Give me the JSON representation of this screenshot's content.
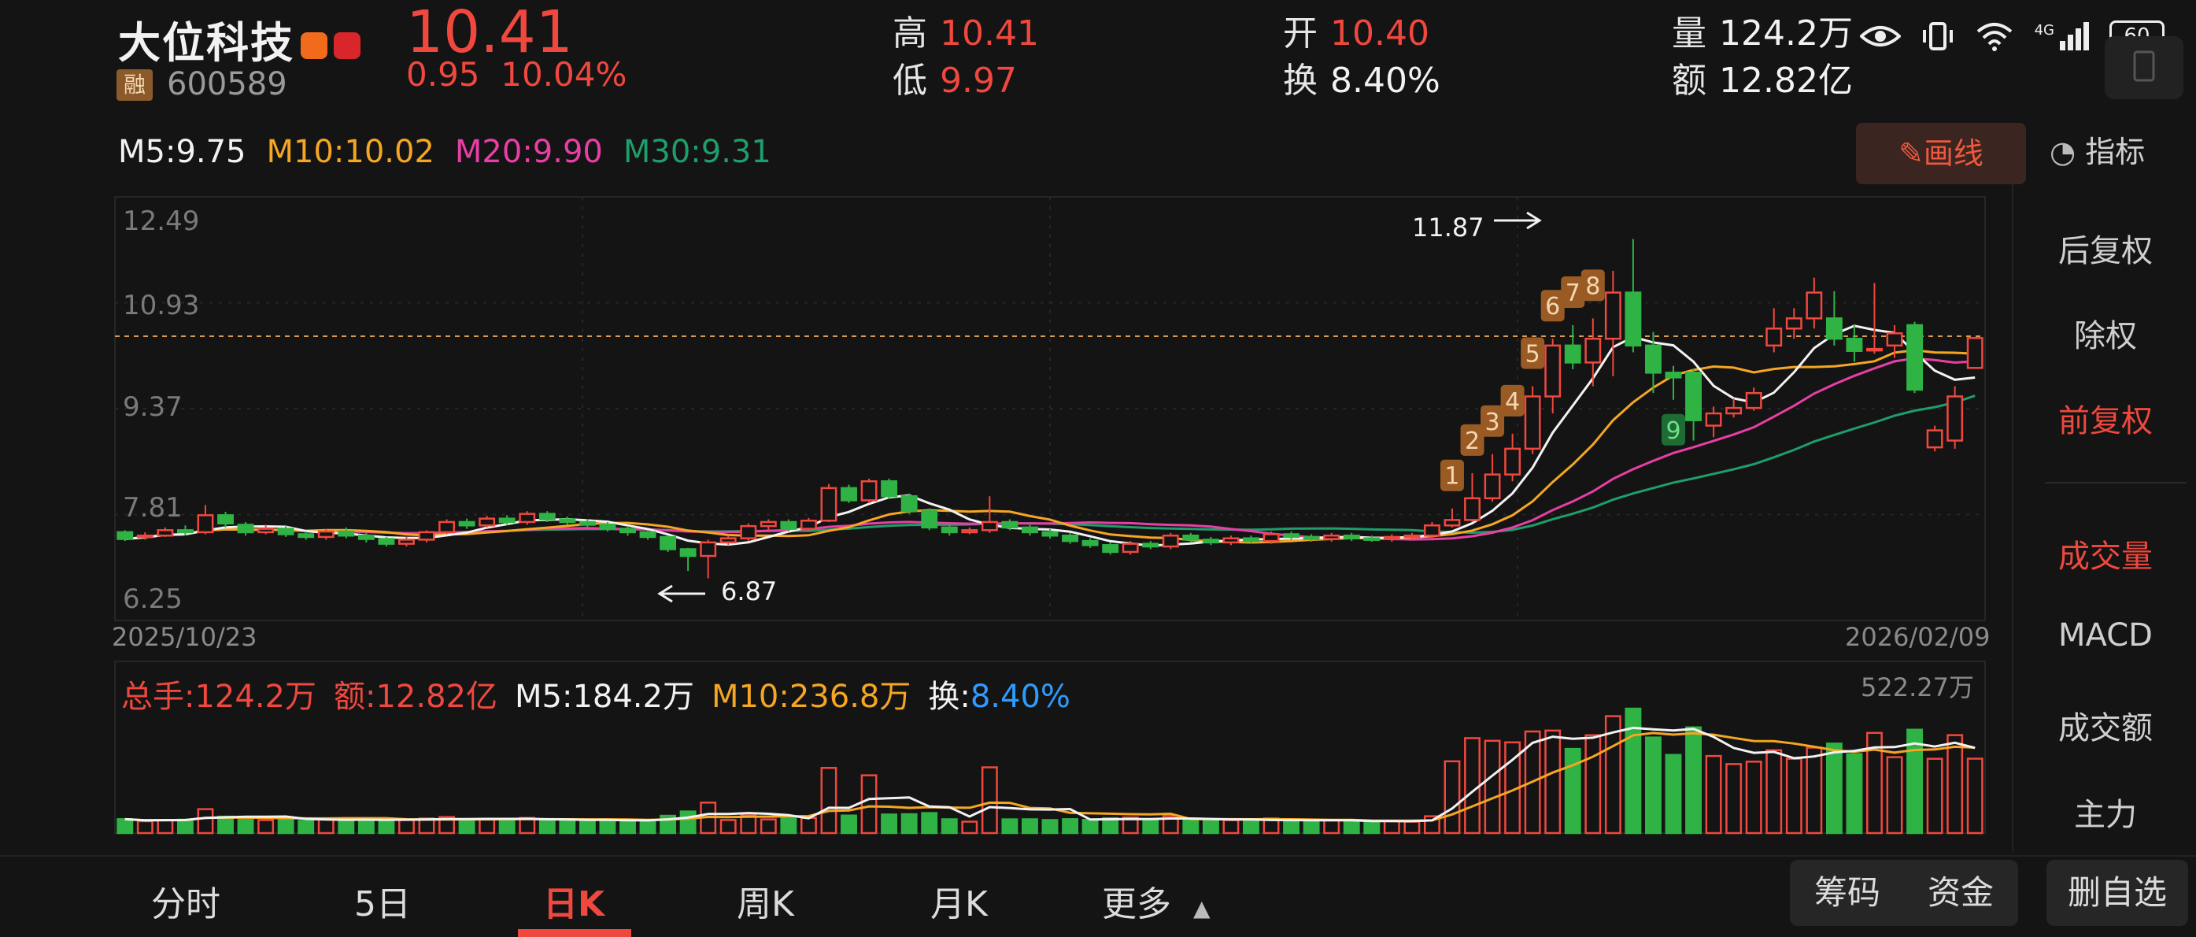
{
  "header": {
    "stock_name": "大位科技",
    "rong_badge": "融",
    "code": "600589",
    "price": "10.41",
    "change": "0.95",
    "change_pct": "10.04%",
    "high_label": "高",
    "high": "10.41",
    "low_label": "低",
    "low": "9.97",
    "open_label": "开",
    "open": "10.40",
    "turnover_label": "换",
    "turnover": "8.40%",
    "volume_label": "量",
    "volume": "124.2万",
    "amount_label": "额",
    "amount": "12.82亿"
  },
  "status_bar": {
    "network": "4G",
    "battery": "60"
  },
  "ma_row": {
    "ma5": "M5:9.75",
    "ma10": "M10:10.02",
    "ma20": "M20:9.90",
    "ma30": "M30:9.31"
  },
  "draw_button": "画线",
  "indicator_button": "指标",
  "side_panel": {
    "items": [
      "后复权",
      "除权",
      "前复权",
      "成交量",
      "MACD",
      "成交额",
      "主力"
    ],
    "active": [
      "前复权",
      "成交量"
    ]
  },
  "chart": {
    "y_ticks": [
      "12.49",
      "10.93",
      "9.37",
      "7.81",
      "6.25"
    ],
    "start_date": "2025/10/23",
    "end_date": "2026/02/09",
    "high_marker": "11.87",
    "low_marker": "6.87",
    "seq_labels": [
      "1",
      "2",
      "3",
      "4",
      "5",
      "6",
      "7",
      "8"
    ],
    "seq_nine": "9",
    "colors": {
      "up": "#f0483e",
      "down": "#2fb344",
      "ma5": "#f2f2f2",
      "ma10": "#f5a623",
      "ma20": "#e83fa6",
      "ma30": "#1e9e6a"
    }
  },
  "volume_row": {
    "total": "总手:124.2万",
    "amount": "额:12.82亿",
    "m5": "M5:184.2万",
    "m10": "M10:236.8万",
    "turnover_label": "换:",
    "turnover": "8.40%",
    "max": "522.27万"
  },
  "bottom_tabs": [
    "分时",
    "5日",
    "日K",
    "周K",
    "月K",
    "更多"
  ],
  "active_tab": "日K",
  "bottom_buttons": [
    "筹码",
    "资金",
    "删自选"
  ],
  "chart_data": {
    "type": "candlestick",
    "y_range": [
      6.25,
      12.49
    ],
    "candles": [
      [
        7.55,
        7.45,
        7.58,
        7.42
      ],
      [
        7.48,
        7.5,
        7.55,
        7.44
      ],
      [
        7.5,
        7.58,
        7.62,
        7.48
      ],
      [
        7.58,
        7.55,
        7.65,
        7.5
      ],
      [
        7.55,
        7.8,
        7.95,
        7.52
      ],
      [
        7.8,
        7.68,
        7.85,
        7.62
      ],
      [
        7.66,
        7.55,
        7.7,
        7.5
      ],
      [
        7.55,
        7.6,
        7.66,
        7.52
      ],
      [
        7.6,
        7.52,
        7.64,
        7.48
      ],
      [
        7.52,
        7.48,
        7.56,
        7.44
      ],
      [
        7.48,
        7.56,
        7.6,
        7.44
      ],
      [
        7.56,
        7.5,
        7.62,
        7.46
      ],
      [
        7.5,
        7.45,
        7.54,
        7.4
      ],
      [
        7.45,
        7.38,
        7.48,
        7.34
      ],
      [
        7.38,
        7.44,
        7.48,
        7.34
      ],
      [
        7.44,
        7.55,
        7.58,
        7.4
      ],
      [
        7.55,
        7.7,
        7.74,
        7.52
      ],
      [
        7.7,
        7.65,
        7.75,
        7.6
      ],
      [
        7.65,
        7.75,
        7.79,
        7.62
      ],
      [
        7.75,
        7.7,
        7.8,
        7.66
      ],
      [
        7.7,
        7.82,
        7.86,
        7.66
      ],
      [
        7.82,
        7.74,
        7.86,
        7.7
      ],
      [
        7.74,
        7.7,
        7.78,
        7.66
      ],
      [
        7.7,
        7.66,
        7.74,
        7.62
      ],
      [
        7.66,
        7.6,
        7.7,
        7.56
      ],
      [
        7.6,
        7.55,
        7.64,
        7.5
      ],
      [
        7.55,
        7.48,
        7.58,
        7.44
      ],
      [
        7.48,
        7.3,
        7.5,
        7.26
      ],
      [
        7.3,
        7.2,
        7.32,
        6.98
      ],
      [
        7.2,
        7.4,
        7.44,
        6.87
      ],
      [
        7.4,
        7.46,
        7.5,
        7.36
      ],
      [
        7.46,
        7.64,
        7.68,
        7.42
      ],
      [
        7.64,
        7.7,
        7.74,
        7.58
      ],
      [
        7.7,
        7.6,
        7.74,
        7.56
      ],
      [
        7.6,
        7.72,
        7.76,
        7.56
      ],
      [
        7.72,
        8.2,
        8.26,
        7.7
      ],
      [
        8.2,
        8.02,
        8.25,
        7.98
      ],
      [
        8.02,
        8.3,
        8.34,
        7.98
      ],
      [
        8.3,
        8.08,
        8.34,
        8.04
      ],
      [
        8.08,
        7.86,
        8.12,
        7.82
      ],
      [
        7.86,
        7.62,
        7.9,
        7.58
      ],
      [
        7.62,
        7.55,
        7.66,
        7.5
      ],
      [
        7.55,
        7.58,
        7.62,
        7.52
      ],
      [
        7.58,
        7.7,
        8.08,
        7.54
      ],
      [
        7.7,
        7.62,
        7.74,
        7.58
      ],
      [
        7.62,
        7.55,
        7.66,
        7.5
      ],
      [
        7.55,
        7.5,
        7.6,
        7.46
      ],
      [
        7.5,
        7.42,
        7.54,
        7.38
      ],
      [
        7.42,
        7.36,
        7.46,
        7.32
      ],
      [
        7.36,
        7.26,
        7.4,
        7.22
      ],
      [
        7.26,
        7.38,
        7.42,
        7.22
      ],
      [
        7.38,
        7.34,
        7.42,
        7.3
      ],
      [
        7.34,
        7.5,
        7.54,
        7.3
      ],
      [
        7.5,
        7.44,
        7.54,
        7.4
      ],
      [
        7.44,
        7.4,
        7.48,
        7.36
      ],
      [
        7.4,
        7.46,
        7.5,
        7.36
      ],
      [
        7.46,
        7.42,
        7.5,
        7.38
      ],
      [
        7.42,
        7.52,
        7.56,
        7.38
      ],
      [
        7.52,
        7.48,
        7.56,
        7.44
      ],
      [
        7.48,
        7.45,
        7.52,
        7.41
      ],
      [
        7.45,
        7.5,
        7.54,
        7.41
      ],
      [
        7.5,
        7.46,
        7.54,
        7.42
      ],
      [
        7.46,
        7.45,
        7.5,
        7.41
      ],
      [
        7.45,
        7.48,
        7.52,
        7.41
      ],
      [
        7.48,
        7.5,
        7.54,
        7.44
      ],
      [
        7.5,
        7.65,
        7.7,
        7.46
      ],
      [
        7.65,
        7.73,
        7.9,
        7.62
      ],
      [
        7.73,
        8.05,
        8.42,
        7.7
      ],
      [
        8.05,
        8.4,
        8.7,
        8.0
      ],
      [
        8.4,
        8.78,
        9.0,
        8.3
      ],
      [
        8.78,
        9.55,
        9.7,
        8.7
      ],
      [
        9.55,
        10.3,
        10.4,
        9.3
      ],
      [
        10.3,
        10.05,
        10.6,
        9.95
      ],
      [
        10.05,
        10.4,
        10.7,
        9.7
      ],
      [
        10.4,
        11.08,
        11.4,
        9.85
      ],
      [
        11.08,
        10.3,
        11.87,
        10.2
      ],
      [
        10.3,
        9.9,
        10.5,
        9.6
      ],
      [
        9.9,
        9.83,
        10.0,
        9.5
      ],
      [
        9.9,
        9.2,
        9.95,
        8.9
      ],
      [
        9.12,
        9.3,
        9.4,
        8.95
      ],
      [
        9.3,
        9.38,
        9.52,
        9.24
      ],
      [
        9.38,
        9.6,
        9.68,
        9.34
      ],
      [
        10.3,
        10.55,
        10.85,
        10.2
      ],
      [
        10.55,
        10.7,
        10.85,
        10.4
      ],
      [
        10.7,
        11.08,
        11.3,
        10.55
      ],
      [
        10.7,
        10.4,
        11.1,
        10.3
      ],
      [
        10.4,
        10.22,
        10.6,
        10.06
      ],
      [
        10.25,
        10.25,
        11.22,
        10.18
      ],
      [
        10.3,
        10.48,
        10.6,
        10.12
      ],
      [
        10.6,
        9.65,
        10.65,
        9.6
      ],
      [
        8.8,
        9.05,
        9.12,
        8.74
      ],
      [
        8.9,
        9.55,
        9.7,
        8.78
      ],
      [
        9.97,
        10.41,
        10.41,
        9.97
      ]
    ],
    "volume": {
      "max": "522.27万"
    }
  }
}
